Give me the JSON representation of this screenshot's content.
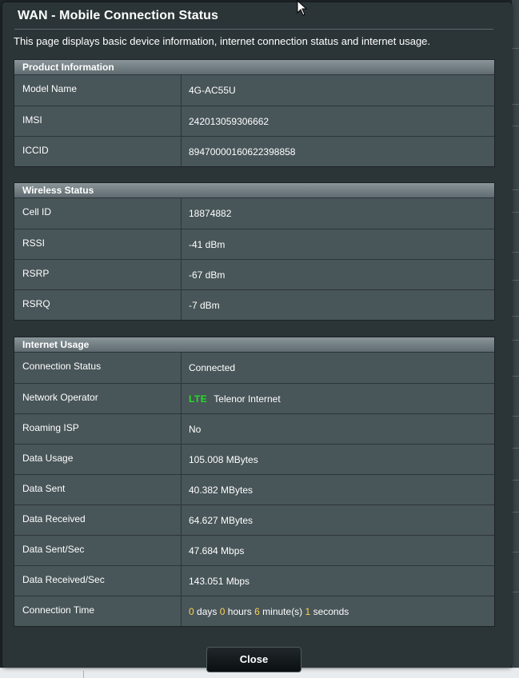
{
  "dialog": {
    "title": "WAN - Mobile Connection Status",
    "description": "This page displays basic device information, internet connection status and internet usage.",
    "close_label": "Close"
  },
  "product_information": {
    "header": "Product Information",
    "rows": [
      {
        "label": "Model Name",
        "value": "4G-AC55U"
      },
      {
        "label": "IMSI",
        "value": "242013059306662"
      },
      {
        "label": "ICCID",
        "value": "89470000160622398858"
      }
    ]
  },
  "wireless_status": {
    "header": "Wireless Status",
    "rows": [
      {
        "label": "Cell ID",
        "value": "18874882"
      },
      {
        "label": "RSSI",
        "value": "-41 dBm"
      },
      {
        "label": "RSRP",
        "value": "-67 dBm"
      },
      {
        "label": "RSRQ",
        "value": "-7 dBm"
      }
    ]
  },
  "internet_usage": {
    "header": "Internet Usage",
    "rows": [
      {
        "label": "Connection Status",
        "value": "Connected"
      },
      {
        "label": "Network Operator",
        "badge": "LTE",
        "value": "Telenor Internet"
      },
      {
        "label": "Roaming ISP",
        "value": "No"
      },
      {
        "label": "Data Usage",
        "value": "105.008 MBytes"
      },
      {
        "label": "Data Sent",
        "value": "40.382 MBytes"
      },
      {
        "label": "Data Received",
        "value": "64.627 MBytes"
      },
      {
        "label": "Data Sent/Sec",
        "value": "47.684 Mbps"
      },
      {
        "label": "Data Received/Sec",
        "value": "143.051 Mbps"
      },
      {
        "label": "Connection Time",
        "days": "0",
        "days_unit": "days",
        "hours": "0",
        "hours_unit": "hours",
        "minutes": "6",
        "minutes_unit": "minute(s)",
        "seconds": "1",
        "seconds_unit": "seconds"
      }
    ]
  },
  "colors": {
    "lte_badge": "#21e021",
    "time_number": "#ffd34d",
    "dialog_bg": "#2b3538",
    "row_bg": "#485559"
  },
  "icons": {
    "cursor": "mouse-pointer-icon"
  }
}
